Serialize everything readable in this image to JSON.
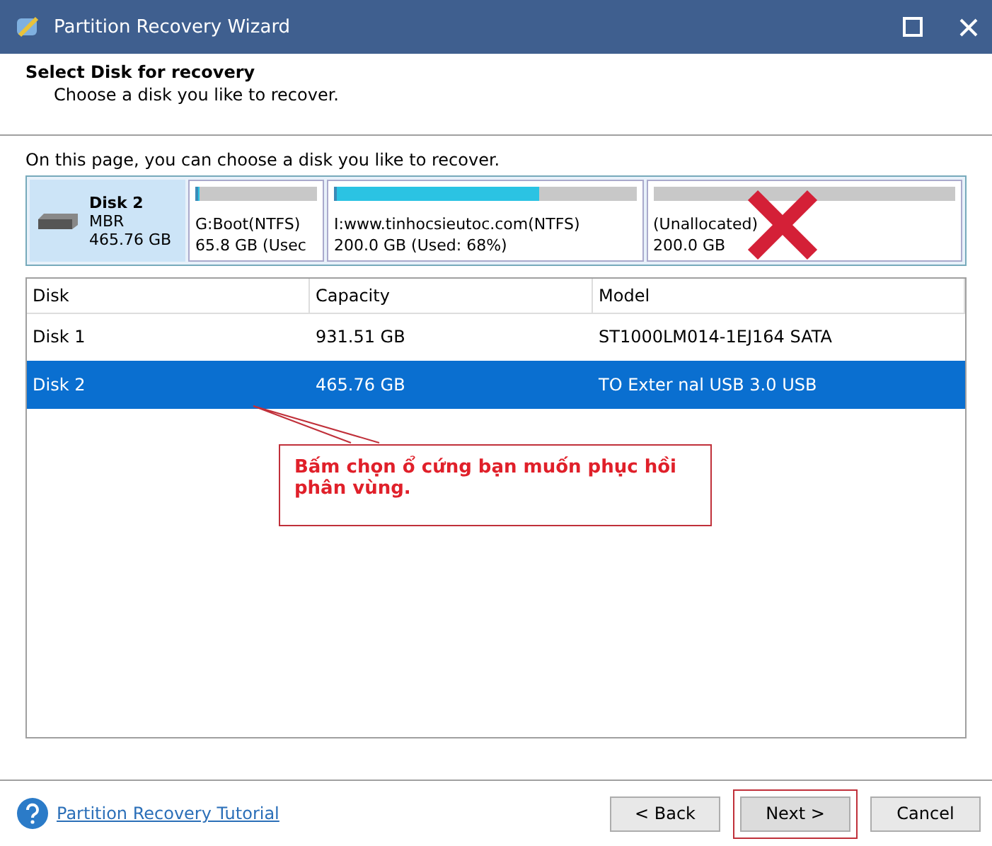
{
  "window": {
    "title": "Partition Recovery Wizard"
  },
  "header": {
    "title": "Select Disk for recovery",
    "subtitle": "Choose a disk you like to recover."
  },
  "instruction": "On this page, you can choose a disk you like to recover.",
  "disk_map": {
    "name": "Disk 2",
    "type": "MBR",
    "size": "465.76 GB",
    "selected": true,
    "partitions": [
      {
        "label": "G:Boot(NTFS)",
        "info": "65.8 GB (Usec",
        "level": 0.03,
        "unallocated": false
      },
      {
        "label": "I:www.tinhocsieutoc.com(NTFS)",
        "info": "200.0 GB (Used: 68%)",
        "level": 0.68,
        "unallocated": false
      },
      {
        "label": "(Unallocated)",
        "info": "200.0 GB",
        "level": 0,
        "unallocated": true
      }
    ]
  },
  "table": {
    "columns": [
      "Disk",
      "Capacity",
      "Model"
    ],
    "rows": [
      {
        "cells": [
          "Disk 1",
          "931.51 GB",
          "ST1000LM014-1EJ164 SATA"
        ],
        "selected": false
      },
      {
        "cells": [
          "Disk 2",
          "465.76 GB",
          "TO Exter nal USB 3.0 USB"
        ],
        "selected": true
      }
    ]
  },
  "callout": "Bấm chọn ổ cứng bạn muốn phục hồi phân vùng.",
  "footer": {
    "link": "Partition Recovery Tutorial",
    "buttons": [
      {
        "label": "< Back",
        "highlighted": false
      },
      {
        "label": "Next >",
        "highlighted": true
      },
      {
        "label": "Cancel",
        "highlighted": false
      }
    ]
  }
}
